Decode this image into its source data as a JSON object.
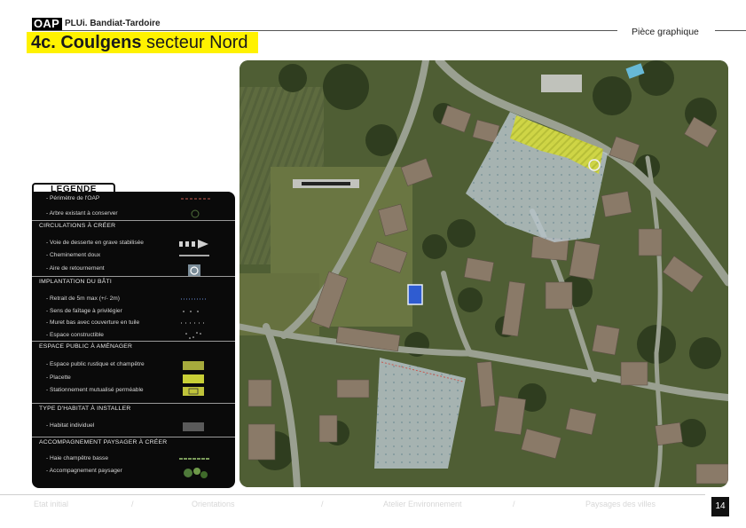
{
  "header": {
    "badge": "OAP",
    "plan_name": "PLUi. Bandiat-Tardoire",
    "piece": "Pièce graphique",
    "title_bold": "4c. Coulgens",
    "title_rest": " secteur Nord"
  },
  "legend": {
    "tab": "LEGENDE",
    "items": [
      {
        "type": "item",
        "label": "- Périmètre de l'OAP",
        "symbol": "perimeter"
      },
      {
        "type": "item",
        "label": "- Arbre existant à conserver",
        "symbol": "tree"
      },
      {
        "type": "head",
        "label": "CIRCULATIONS À CRÉER"
      },
      {
        "type": "item",
        "label": "- Voie de desserte en grave stabilisée",
        "symbol": "arrow"
      },
      {
        "type": "item",
        "label": "- Cheminement doux",
        "symbol": "line"
      },
      {
        "type": "item",
        "label": "- Aire de retournement",
        "symbol": "turn"
      },
      {
        "type": "head",
        "label": "IMPLANTATION DU BÂTI"
      },
      {
        "type": "item",
        "label": "- Retrait de 5m max (+/- 2m)",
        "symbol": "dots-blue"
      },
      {
        "type": "item",
        "label": "- Sens de faîtage à privilégier",
        "symbol": "dashes"
      },
      {
        "type": "item",
        "label": "- Muret bas avec couverture en tuile",
        "symbol": "dashes-fine"
      },
      {
        "type": "item",
        "label": "- Espace constructible",
        "symbol": "dots-white"
      },
      {
        "type": "head",
        "label": "ESPACE PUBLIC À AMÉNAGER"
      },
      {
        "type": "item",
        "label": "- Espace public rustique et champêtre",
        "symbol": "hatch-olive"
      },
      {
        "type": "item",
        "label": "- Placette",
        "symbol": "hatch-yellow"
      },
      {
        "type": "item",
        "label": "- Stationnement mutualisé perméable",
        "symbol": "parking"
      },
      {
        "type": "head",
        "label": "TYPE D'HABITAT À INSTALLER"
      },
      {
        "type": "item",
        "label": "- Habitat individuel",
        "symbol": "grey-box"
      },
      {
        "type": "head",
        "label": "ACCOMPAGNEMENT PAYSAGER À CRÉER"
      },
      {
        "type": "item",
        "label": "- Haie champêtre basse",
        "symbol": "hedge"
      },
      {
        "type": "item",
        "label": "- Accompagnement paysager",
        "symbol": "shrubs"
      }
    ]
  },
  "footer": {
    "items": [
      "Etat initial",
      "Orientations",
      "Atelier Environnement",
      "Paysages des villes"
    ],
    "page": "14"
  },
  "colors": {
    "accent_yellow": "#fff200",
    "legend_bg": "#0a0a0a",
    "oap_zone": "#b8c6cd",
    "placette": "#d6dc3a"
  }
}
